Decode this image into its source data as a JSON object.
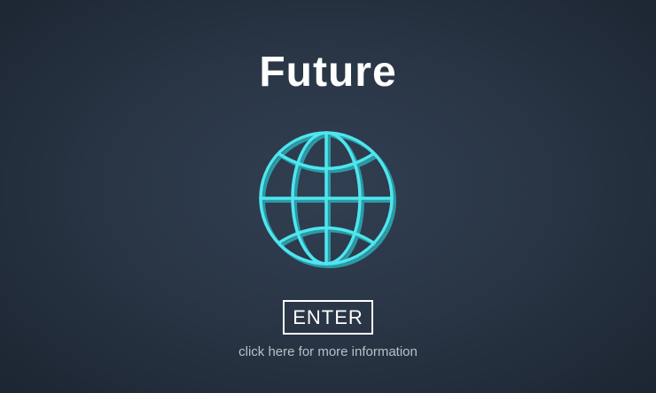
{
  "page": {
    "title": "Future"
  },
  "enter_button": {
    "label": "ENTER"
  },
  "info_link": {
    "text": "click here for more information"
  },
  "icons": {
    "globe": "globe-icon"
  },
  "colors": {
    "background": "#2a3646",
    "accent": "#4fe6ee",
    "accent_shadow": "#2b9aa6",
    "text": "#ffffff",
    "muted_text": "#b9c0c9"
  }
}
